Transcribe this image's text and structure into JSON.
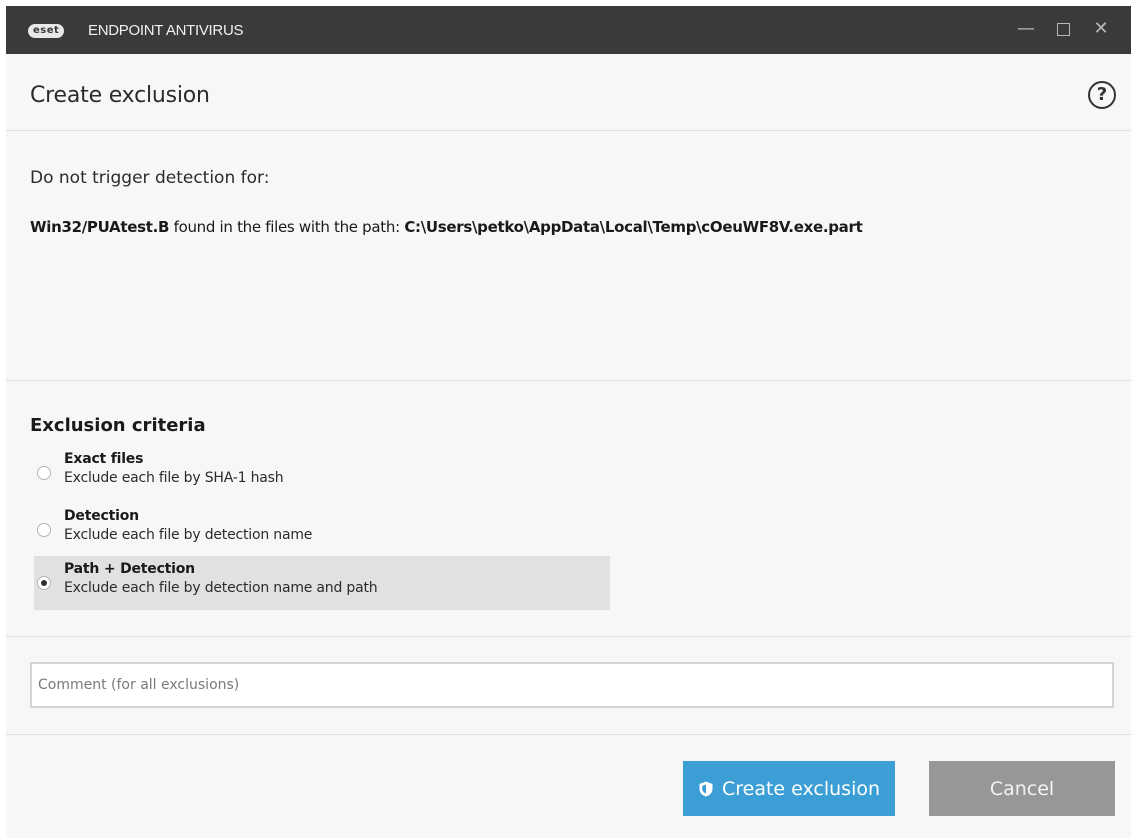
{
  "window": {
    "logo_text": "eset",
    "app_title": "ENDPOINT ANTIVIRUS",
    "controls": {
      "minimize": "—",
      "maximize": "",
      "close": "✕"
    }
  },
  "header": {
    "title": "Create exclusion",
    "help": "?"
  },
  "intro": "Do not trigger detection for:",
  "detail": {
    "detection": "Win32/PUAtest.B",
    "middle_text": " found in the files with the path: ",
    "path": "C:\\Users\\petko\\AppData\\Local\\Temp\\cOeuWF8V.exe.part"
  },
  "criteria": {
    "title": "Exclusion criteria",
    "options": [
      {
        "label": "Exact files",
        "description": "Exclude each file by SHA-1 hash",
        "selected": false
      },
      {
        "label": "Detection",
        "description": "Exclude each file by detection name",
        "selected": false
      },
      {
        "label": "Path + Detection",
        "description": "Exclude each file by detection name and path",
        "selected": true
      }
    ]
  },
  "comment": {
    "placeholder": "Comment (for all exclusions)",
    "value": ""
  },
  "actions": {
    "create_label": "Create exclusion",
    "cancel_label": "Cancel"
  },
  "colors": {
    "accent": "#3b9fd6",
    "titlebar": "#3a3a3a",
    "cancel": "#979797"
  },
  "icons": {
    "help": "question-circle-icon",
    "create": "shield-icon",
    "radio": "radio-icon"
  }
}
